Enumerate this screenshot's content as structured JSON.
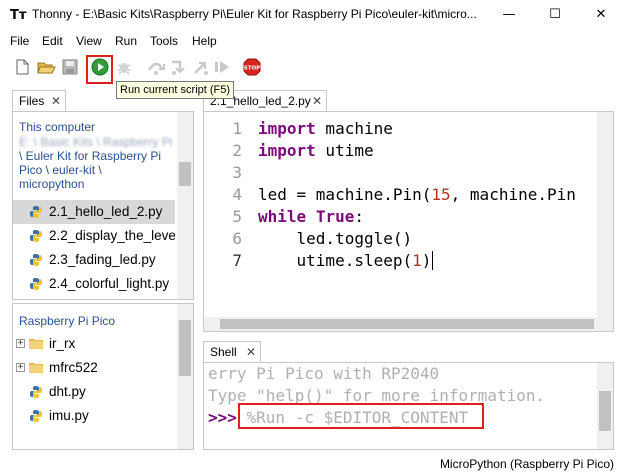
{
  "window": {
    "app_icon": "Tт",
    "title": "Thonny  -  E:\\Basic Kits\\Raspberry Pi\\Euler Kit for Raspberry Pi Pico\\euler-kit\\micro...",
    "minimize": "—",
    "maximize": "☐",
    "close": "✕"
  },
  "menu": [
    "File",
    "Edit",
    "View",
    "Run",
    "Tools",
    "Help"
  ],
  "toolbar": {
    "icons": [
      "new-file-icon",
      "open-file-icon",
      "save-file-icon",
      "run-icon",
      "debug-icon",
      "step-over-icon",
      "step-into-icon",
      "step-out-icon",
      "resume-icon",
      "stop-icon"
    ],
    "stop_label": "STOP",
    "tooltip": "Run current script (F5)"
  },
  "files_panel": {
    "tab_label": "Files",
    "computer_heading": "This computer",
    "computer_path_lines": [
      "E: \\ Basic Kits \\ Raspberry Pi",
      "\\ Euler Kit for Raspberry Pi",
      "Pico \\ euler-kit \\",
      "micropython"
    ],
    "files": [
      {
        "name": "2.1_hello_led_2.py",
        "selected": true
      },
      {
        "name": "2.2_display_the_leve",
        "selected": false
      },
      {
        "name": "2.3_fading_led.py",
        "selected": false
      },
      {
        "name": "2.4_colorful_light.py",
        "selected": false
      }
    ],
    "device_heading": "Raspberry Pi Pico",
    "device_items": [
      {
        "name": "ir_rx",
        "type": "folder"
      },
      {
        "name": "mfrc522",
        "type": "folder"
      },
      {
        "name": "dht.py",
        "type": "file"
      },
      {
        "name": "imu.py",
        "type": "file"
      }
    ]
  },
  "editor": {
    "tab_label": "2.1_hello_led_2.py",
    "line_numbers": [
      "1",
      "2",
      "3",
      "4",
      "5",
      "6",
      "7"
    ],
    "lines": [
      {
        "kw": "import",
        "rest": " machine",
        "num": "",
        "tail": ""
      },
      {
        "kw": "import",
        "rest": " utime",
        "num": "",
        "tail": ""
      },
      {
        "kw": "",
        "rest": "",
        "num": "",
        "tail": ""
      },
      {
        "kw": "",
        "rest": "led = machine.Pin(",
        "num": "15",
        "tail": ", machine.Pin"
      },
      {
        "kw": "while",
        "rest": " ",
        "num": "",
        "tail": "",
        "kw2": "True",
        "after": ":"
      },
      {
        "kw": "",
        "rest": "    led.toggle()",
        "num": "",
        "tail": ""
      },
      {
        "kw": "",
        "rest": "    utime.sleep(",
        "num": "1",
        "tail": ")"
      }
    ]
  },
  "shell": {
    "tab_label": "Shell",
    "lines": [
      "erry Pi Pico with RP2040",
      "Type \"help()\" for more information."
    ],
    "prompt": ">>> ",
    "command": "%Run -c $EDITOR_CONTENT"
  },
  "status": {
    "interpreter": "MicroPython (Raspberry Pi Pico)"
  },
  "colors": {
    "highlight_box": "#e0201e",
    "keyword": "#7a0a7a",
    "number": "#b5321e"
  }
}
